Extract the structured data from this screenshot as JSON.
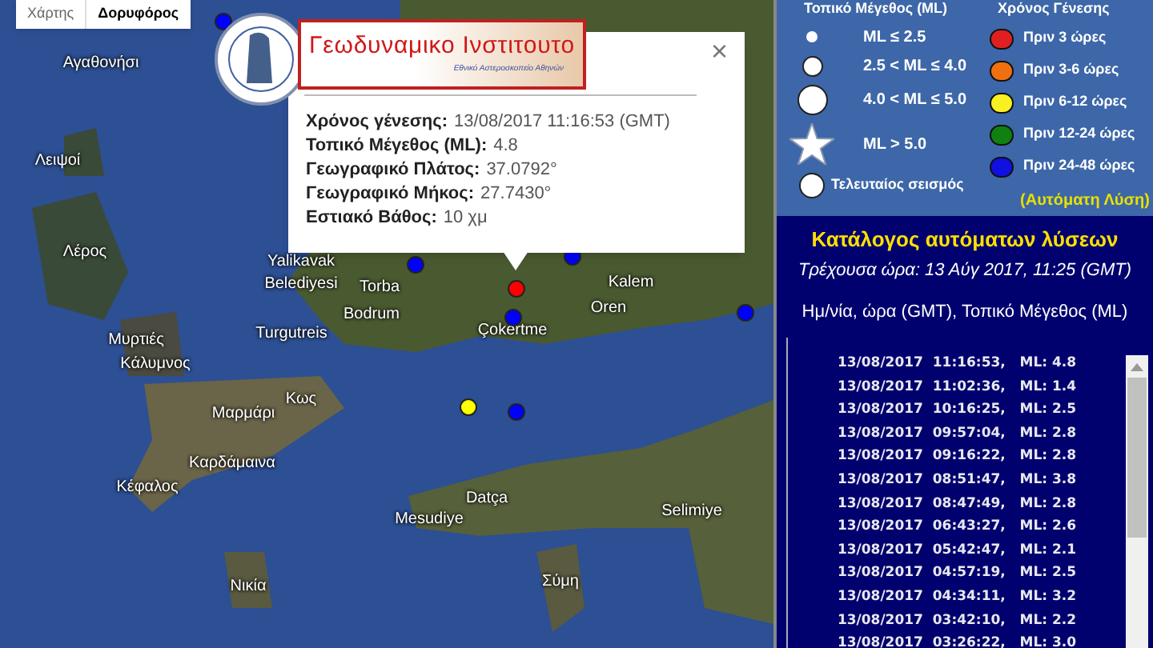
{
  "map_type": [
    {
      "label": "Χάρτης",
      "selected": false
    },
    {
      "label": "Δορυφόρος",
      "selected": true
    }
  ],
  "place_labels": [
    "Αγαθονήσι",
    "Λειψοί",
    "Λέρος",
    "Yalikavak",
    "Belediyesi",
    "Torba",
    "Bodrum",
    "Turgutreis",
    "Μυρτιές",
    "Κάλυμνος",
    "Κως",
    "Μαρμάρι",
    "Καρδάμαινα",
    "Κέφαλος",
    "Νικία",
    "Mesudiye",
    "Datça",
    "Σύμη",
    "Selimiye",
    "Kalem",
    "Oren",
    "Çokertme"
  ],
  "markers": [
    {
      "color": "#ff0000"
    },
    {
      "color": "#0000ff"
    },
    {
      "color": "#0000ff"
    },
    {
      "color": "#0000ff"
    },
    {
      "color": "#0000ff"
    },
    {
      "color": "#0000ff"
    },
    {
      "color": "#ffff00"
    },
    {
      "color": "#0000ff"
    }
  ],
  "popup": {
    "institute": "Γεωδυναμικο Ινστιτουτο",
    "institute_subtitle": "Εθνικό Αστεροσκοπείο Αθηνών",
    "fields": [
      {
        "label": "Χρόνος γένεσης:",
        "value": "13/08/2017  11:16:53 (GMT)"
      },
      {
        "label": "Τοπικό Μέγεθος (ML):",
        "value": "4.8"
      },
      {
        "label": "Γεωγραφικό Πλάτος:",
        "value": "37.0792°"
      },
      {
        "label": "Γεωγραφικό Μήκος:",
        "value": "27.7430°"
      },
      {
        "label": "Εστιακό Βάθος:",
        "value": "10 χμ"
      }
    ],
    "close": "×"
  },
  "legend": {
    "size_title": "Τοπικό Μέγεθος (ML)",
    "time_title": "Χρόνος Γένεσης",
    "sizes": [
      {
        "kind": "small",
        "label": "ML ≤ 2.5"
      },
      {
        "kind": "medium",
        "label": "2.5 < ML ≤ 4.0"
      },
      {
        "kind": "large",
        "label": "4.0 < ML ≤ 5.0"
      },
      {
        "kind": "star",
        "label": "ML > 5.0"
      },
      {
        "kind": "latest",
        "label": "Τελευταίος σεισμός"
      }
    ],
    "times": [
      {
        "label": "Πριν 3 ώρες",
        "color": "#e02020"
      },
      {
        "label": "Πριν 3-6 ώρες",
        "color": "#f07010"
      },
      {
        "label": "Πριν 6-12 ώρες",
        "color": "#f8f020"
      },
      {
        "label": "Πριν 12-24 ώρες",
        "color": "#108010"
      },
      {
        "label": "Πριν 24-48 ώρες",
        "color": "#1010e0"
      }
    ],
    "note": "(Αυτόματη Λύση)"
  },
  "catalog": {
    "title": "Κατάλογος αυτόματων λύσεων",
    "current_time": "Τρέχουσα ώρα: 13 Αύγ 2017, 11:25 (GMT)",
    "header": "Ημ/νία, ώρα (GMT), Τοπικό Μέγεθος (ML)",
    "rows": [
      "13/08/2017  11:16:53,   ML: 4.8",
      "13/08/2017  11:02:36,   ML: 1.4",
      "13/08/2017  10:16:25,   ML: 2.5",
      "13/08/2017  09:57:04,   ML: 2.8",
      "13/08/2017  09:16:22,   ML: 2.8",
      "13/08/2017  08:51:47,   ML: 3.8",
      "13/08/2017  08:47:49,   ML: 2.8",
      "13/08/2017  06:43:27,   ML: 2.6",
      "13/08/2017  05:42:47,   ML: 2.1",
      "13/08/2017  04:57:19,   ML: 2.5",
      "13/08/2017  04:34:11,   ML: 3.2",
      "13/08/2017  03:42:10,   ML: 2.2",
      "13/08/2017  03:26:22,   ML: 3.0"
    ]
  }
}
